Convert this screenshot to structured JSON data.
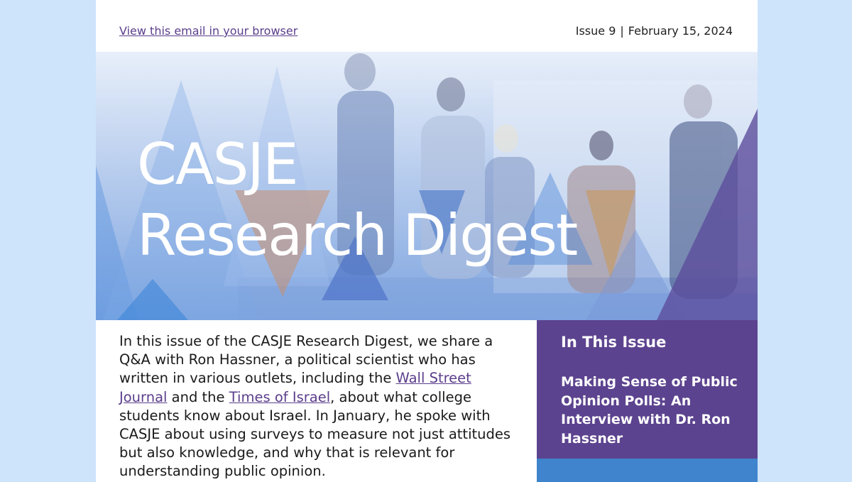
{
  "header": {
    "browser_link": "View this email in your browser",
    "issue_label": "Issue 9",
    "separator": "|",
    "date": "February 15, 2024"
  },
  "hero": {
    "title_line1": "CASJE",
    "title_line2": "Research Digest"
  },
  "intro": {
    "text_before_link1": "In this issue of the CASJE Research Digest, we share a Q&A with Ron Hassner, a political scientist who has written in various outlets, including the ",
    "link1": "Wall Street Journal",
    "text_between_links": " and the ",
    "link2": "Times of Israel",
    "text_after_link2": ", about what college students know about Israel. In January, he spoke with CASJE about using surveys to measure not just attitudes but also knowledge, and why that is relevant for understanding public opinion."
  },
  "sidebar": {
    "title": "In This Issue",
    "link": "Making Sense of Public Opinion Polls: An Interview with Dr. Ron Hassner"
  },
  "colors": {
    "page_background": "#cde4fb",
    "link": "#5b3e8c",
    "sidebar_background": "#5c438f",
    "sidebar_bottom": "#3f84cc"
  }
}
